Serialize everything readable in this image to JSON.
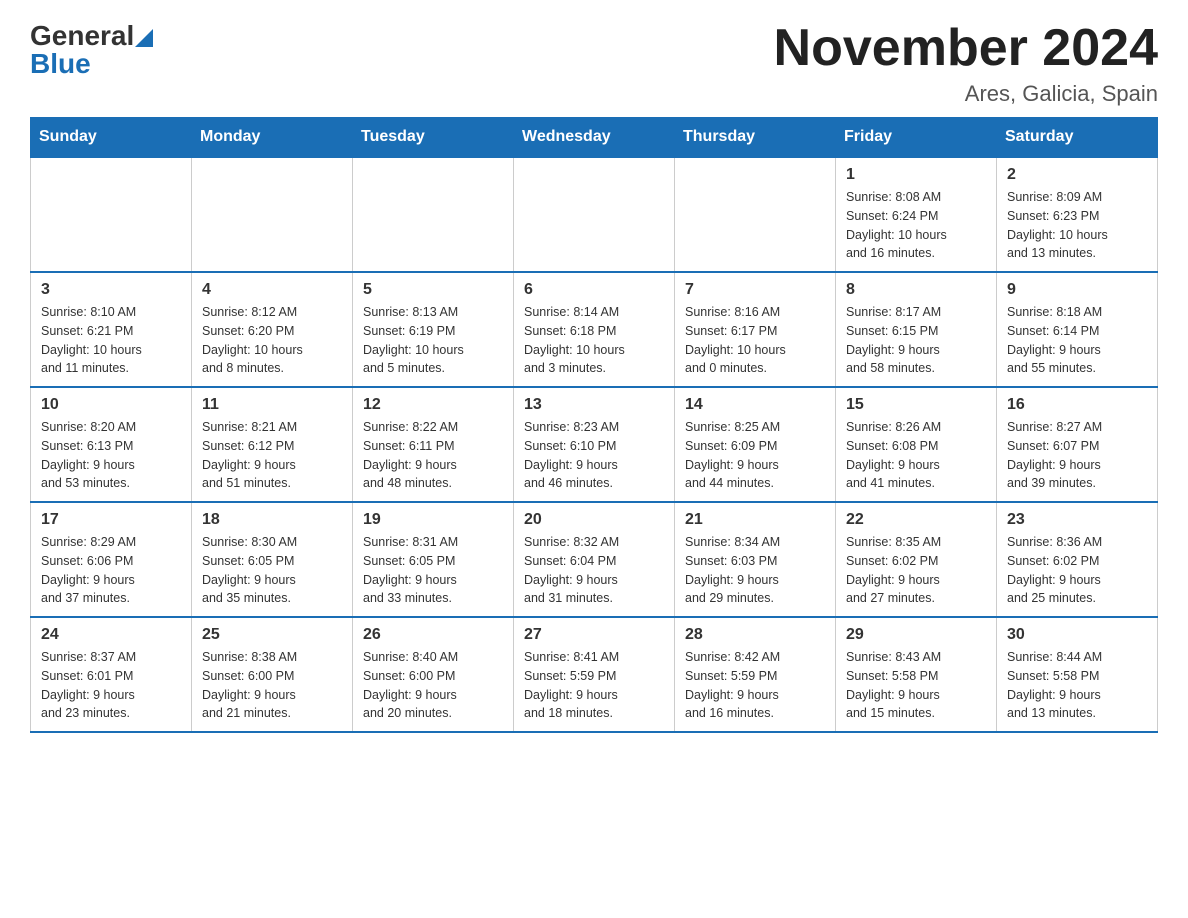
{
  "header": {
    "logo_general": "General",
    "logo_blue": "Blue",
    "month_title": "November 2024",
    "location": "Ares, Galicia, Spain"
  },
  "weekdays": [
    "Sunday",
    "Monday",
    "Tuesday",
    "Wednesday",
    "Thursday",
    "Friday",
    "Saturday"
  ],
  "weeks": [
    [
      {
        "day": "",
        "info": ""
      },
      {
        "day": "",
        "info": ""
      },
      {
        "day": "",
        "info": ""
      },
      {
        "day": "",
        "info": ""
      },
      {
        "day": "",
        "info": ""
      },
      {
        "day": "1",
        "info": "Sunrise: 8:08 AM\nSunset: 6:24 PM\nDaylight: 10 hours\nand 16 minutes."
      },
      {
        "day": "2",
        "info": "Sunrise: 8:09 AM\nSunset: 6:23 PM\nDaylight: 10 hours\nand 13 minutes."
      }
    ],
    [
      {
        "day": "3",
        "info": "Sunrise: 8:10 AM\nSunset: 6:21 PM\nDaylight: 10 hours\nand 11 minutes."
      },
      {
        "day": "4",
        "info": "Sunrise: 8:12 AM\nSunset: 6:20 PM\nDaylight: 10 hours\nand 8 minutes."
      },
      {
        "day": "5",
        "info": "Sunrise: 8:13 AM\nSunset: 6:19 PM\nDaylight: 10 hours\nand 5 minutes."
      },
      {
        "day": "6",
        "info": "Sunrise: 8:14 AM\nSunset: 6:18 PM\nDaylight: 10 hours\nand 3 minutes."
      },
      {
        "day": "7",
        "info": "Sunrise: 8:16 AM\nSunset: 6:17 PM\nDaylight: 10 hours\nand 0 minutes."
      },
      {
        "day": "8",
        "info": "Sunrise: 8:17 AM\nSunset: 6:15 PM\nDaylight: 9 hours\nand 58 minutes."
      },
      {
        "day": "9",
        "info": "Sunrise: 8:18 AM\nSunset: 6:14 PM\nDaylight: 9 hours\nand 55 minutes."
      }
    ],
    [
      {
        "day": "10",
        "info": "Sunrise: 8:20 AM\nSunset: 6:13 PM\nDaylight: 9 hours\nand 53 minutes."
      },
      {
        "day": "11",
        "info": "Sunrise: 8:21 AM\nSunset: 6:12 PM\nDaylight: 9 hours\nand 51 minutes."
      },
      {
        "day": "12",
        "info": "Sunrise: 8:22 AM\nSunset: 6:11 PM\nDaylight: 9 hours\nand 48 minutes."
      },
      {
        "day": "13",
        "info": "Sunrise: 8:23 AM\nSunset: 6:10 PM\nDaylight: 9 hours\nand 46 minutes."
      },
      {
        "day": "14",
        "info": "Sunrise: 8:25 AM\nSunset: 6:09 PM\nDaylight: 9 hours\nand 44 minutes."
      },
      {
        "day": "15",
        "info": "Sunrise: 8:26 AM\nSunset: 6:08 PM\nDaylight: 9 hours\nand 41 minutes."
      },
      {
        "day": "16",
        "info": "Sunrise: 8:27 AM\nSunset: 6:07 PM\nDaylight: 9 hours\nand 39 minutes."
      }
    ],
    [
      {
        "day": "17",
        "info": "Sunrise: 8:29 AM\nSunset: 6:06 PM\nDaylight: 9 hours\nand 37 minutes."
      },
      {
        "day": "18",
        "info": "Sunrise: 8:30 AM\nSunset: 6:05 PM\nDaylight: 9 hours\nand 35 minutes."
      },
      {
        "day": "19",
        "info": "Sunrise: 8:31 AM\nSunset: 6:05 PM\nDaylight: 9 hours\nand 33 minutes."
      },
      {
        "day": "20",
        "info": "Sunrise: 8:32 AM\nSunset: 6:04 PM\nDaylight: 9 hours\nand 31 minutes."
      },
      {
        "day": "21",
        "info": "Sunrise: 8:34 AM\nSunset: 6:03 PM\nDaylight: 9 hours\nand 29 minutes."
      },
      {
        "day": "22",
        "info": "Sunrise: 8:35 AM\nSunset: 6:02 PM\nDaylight: 9 hours\nand 27 minutes."
      },
      {
        "day": "23",
        "info": "Sunrise: 8:36 AM\nSunset: 6:02 PM\nDaylight: 9 hours\nand 25 minutes."
      }
    ],
    [
      {
        "day": "24",
        "info": "Sunrise: 8:37 AM\nSunset: 6:01 PM\nDaylight: 9 hours\nand 23 minutes."
      },
      {
        "day": "25",
        "info": "Sunrise: 8:38 AM\nSunset: 6:00 PM\nDaylight: 9 hours\nand 21 minutes."
      },
      {
        "day": "26",
        "info": "Sunrise: 8:40 AM\nSunset: 6:00 PM\nDaylight: 9 hours\nand 20 minutes."
      },
      {
        "day": "27",
        "info": "Sunrise: 8:41 AM\nSunset: 5:59 PM\nDaylight: 9 hours\nand 18 minutes."
      },
      {
        "day": "28",
        "info": "Sunrise: 8:42 AM\nSunset: 5:59 PM\nDaylight: 9 hours\nand 16 minutes."
      },
      {
        "day": "29",
        "info": "Sunrise: 8:43 AM\nSunset: 5:58 PM\nDaylight: 9 hours\nand 15 minutes."
      },
      {
        "day": "30",
        "info": "Sunrise: 8:44 AM\nSunset: 5:58 PM\nDaylight: 9 hours\nand 13 minutes."
      }
    ]
  ]
}
